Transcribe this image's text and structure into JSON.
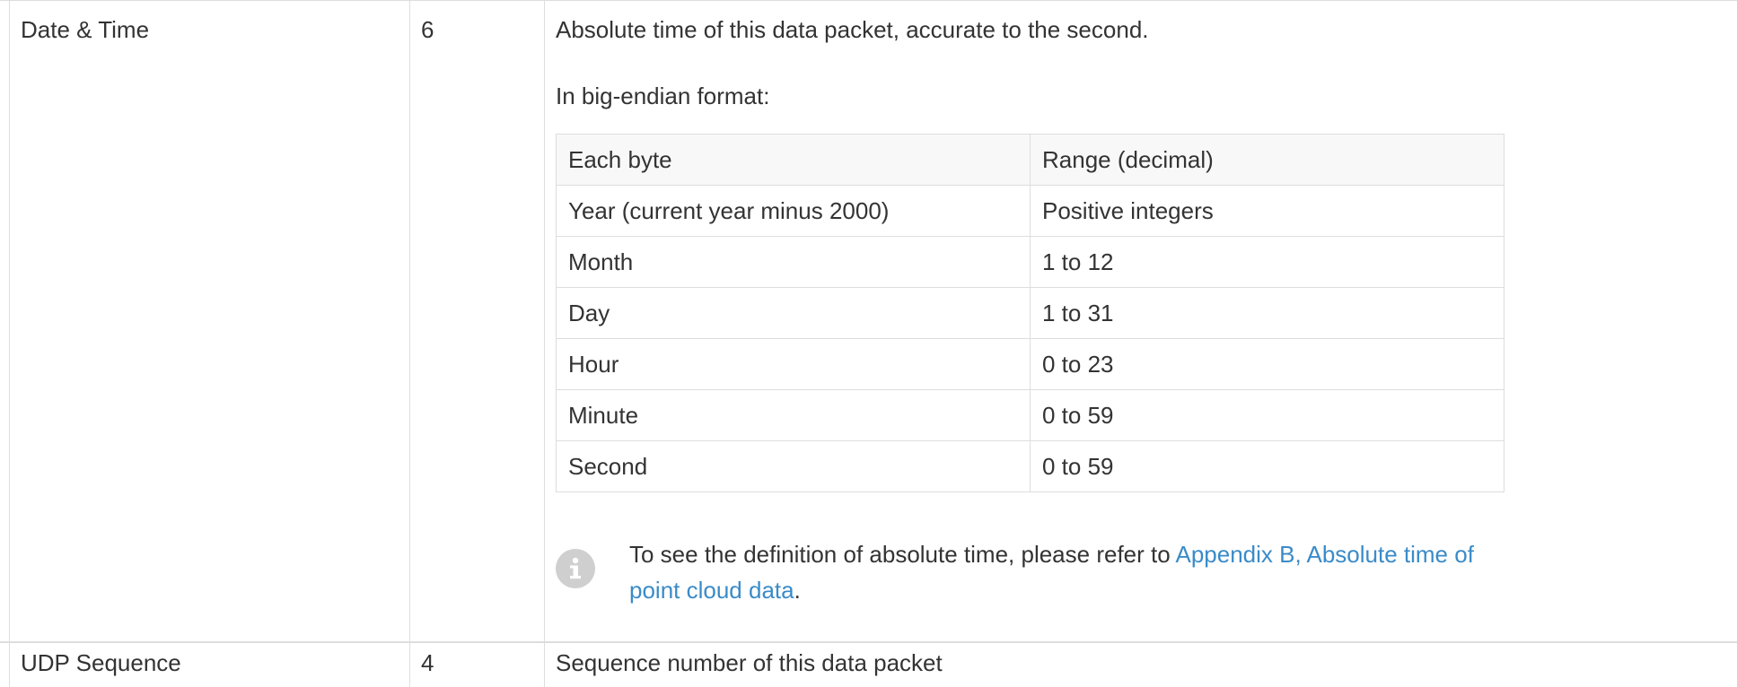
{
  "rows": [
    {
      "field": "Date & Time",
      "size": "6",
      "desc_line1": "Absolute time of this data packet, accurate to the second.",
      "desc_line2": "In big-endian format:"
    },
    {
      "field": "UDP Sequence",
      "size": "4",
      "desc_line1": "Sequence number of this data packet"
    }
  ],
  "byte_table": {
    "headers": [
      "Each byte",
      "Range (decimal)"
    ],
    "rows": [
      [
        "Year (current year minus 2000)",
        "Positive integers"
      ],
      [
        "Month",
        "1 to 12"
      ],
      [
        "Day",
        "1 to 31"
      ],
      [
        "Hour",
        "0 to 23"
      ],
      [
        "Minute",
        "0 to 59"
      ],
      [
        "Second",
        "0 to 59"
      ]
    ]
  },
  "note": {
    "icon": "info-icon",
    "text_before": "To see the definition of absolute time, please refer to ",
    "link_text": "Appendix B, Absolute time of point cloud data",
    "text_after": "."
  },
  "colors": {
    "link": "#3a8bc8",
    "border": "#dddddd",
    "header_bg": "#f8f8f8",
    "icon_bg": "#cfcfcf"
  }
}
